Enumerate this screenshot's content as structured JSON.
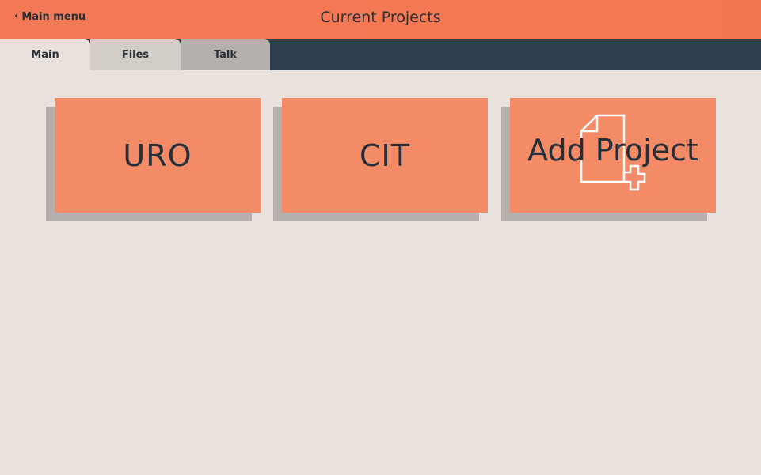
{
  "header": {
    "back_label": "Main menu",
    "title": "Current Projects"
  },
  "tabs": [
    {
      "label": "Main",
      "active": true
    },
    {
      "label": "Files",
      "active": false
    },
    {
      "label": "Talk",
      "active": false
    }
  ],
  "projects": [
    {
      "label": "URO"
    },
    {
      "label": "CIT"
    }
  ],
  "add_project": {
    "label": "Add Project",
    "icon": "file-plus-icon"
  },
  "colors": {
    "header": "#f37856",
    "tabbar": "#2e3f50",
    "background": "#e9e2dc",
    "card": "#f38b66",
    "card_shadow": "#b5b0ae"
  }
}
